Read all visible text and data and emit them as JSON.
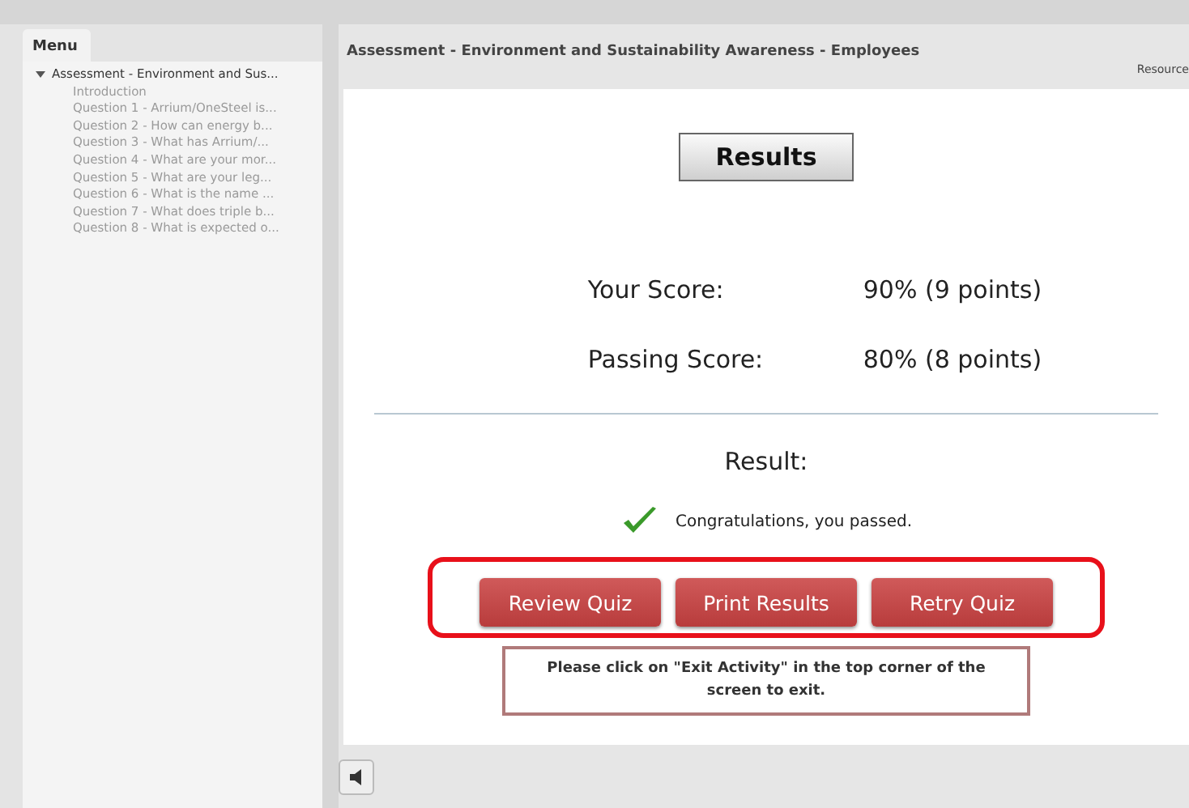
{
  "sidebar": {
    "tab": "Menu",
    "tree": [
      {
        "label": "Assessment - Environment and Sus...",
        "expanded": true,
        "children": [
          {
            "label": "Introduction"
          },
          {
            "label": "Question 1 - Arrium/OneSteel is..."
          },
          {
            "label": "Question 2 - How can energy b..."
          },
          {
            "label": "Question 3 - What has Arrium/..."
          },
          {
            "label": "Question 4 - What are your mor..."
          },
          {
            "label": "Question 5 - What are your leg..."
          },
          {
            "label": "Question 6 - What is the name ..."
          },
          {
            "label": "Question 7 - What does triple b..."
          },
          {
            "label": "Question 8 - What is expected o..."
          }
        ]
      }
    ]
  },
  "header": {
    "title": "Assessment - Environment and Sustainability Awareness - Employees",
    "link": "Resource"
  },
  "results": {
    "heading": "Results",
    "scores": [
      {
        "label": "Your Score:",
        "value": "90% (9 points)"
      },
      {
        "label": "Passing Score:",
        "value": "80% (8 points)"
      }
    ],
    "result_label": "Result:",
    "passed": true,
    "message": "Congratulations, you passed.",
    "buttons": [
      "Review Quiz",
      "Print Results",
      "Retry Quiz"
    ],
    "notice": "Please click on \"Exit Activity\" in the top corner of the screen to exit."
  }
}
